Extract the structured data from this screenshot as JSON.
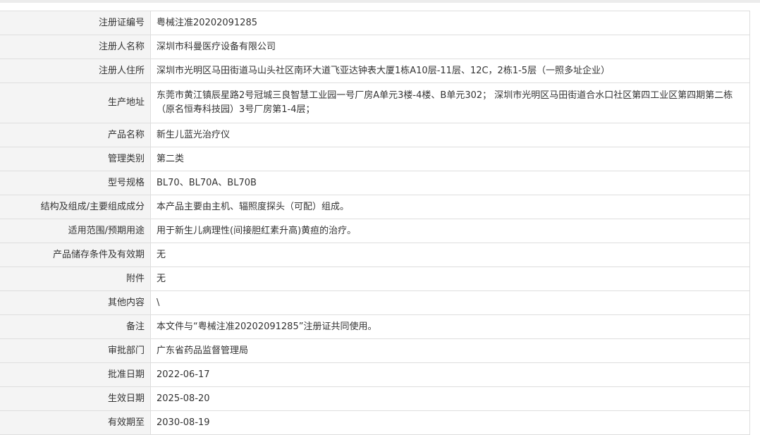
{
  "rows": [
    {
      "label": "注册证编号",
      "value": "粤械注准20202091285"
    },
    {
      "label": "注册人名称",
      "value": "深圳市科曼医疗设备有限公司"
    },
    {
      "label": "注册人住所",
      "value": "深圳市光明区马田街道马山头社区南环大道飞亚达钟表大厦1栋A10层-11层、12C，2栋1-5层（一照多址企业）"
    },
    {
      "label": "生产地址",
      "value": "东莞市黄江镇辰星路2号冠城三良智慧工业园一号厂房A单元3楼-4楼、B单元302；  深圳市光明区马田街道合水口社区第四工业区第四期第二栋（原名恒寿科技园）3号厂房第1-4层；"
    },
    {
      "label": "产品名称",
      "value": "新生儿蓝光治疗仪"
    },
    {
      "label": "管理类别",
      "value": "第二类"
    },
    {
      "label": "型号规格",
      "value": "BL70、BL70A、BL70B"
    },
    {
      "label": "结构及组成/主要组成成分",
      "value": "本产品主要由主机、辐照度探头（可配）组成。"
    },
    {
      "label": "适用范围/预期用途",
      "value": "用于新生儿病理性(间接胆红素升高)黄疸的治疗。"
    },
    {
      "label": "产品储存条件及有效期",
      "value": "无"
    },
    {
      "label": "附件",
      "value": "无"
    },
    {
      "label": "其他内容",
      "value": "\\"
    },
    {
      "label": "备注",
      "value": "本文件与“粤械注准20202091285”注册证共同使用。"
    },
    {
      "label": "审批部门",
      "value": "广东省药品监督管理局"
    },
    {
      "label": "批准日期",
      "value": "2022-06-17"
    },
    {
      "label": "生效日期",
      "value": "2025-08-20"
    },
    {
      "label": "有效期至",
      "value": "2030-08-19"
    }
  ]
}
